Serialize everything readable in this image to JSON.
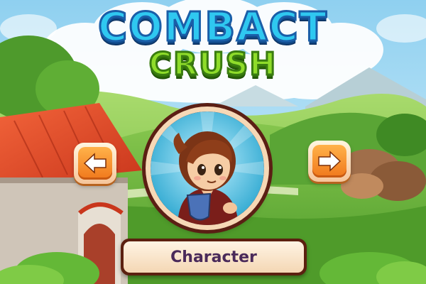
{
  "game": {
    "title_line1": "COMBACT",
    "title_line2": "CRUSH",
    "character_button_label": "Character"
  },
  "icons": {
    "prev": "arrow-left-icon",
    "next": "arrow-right-icon"
  },
  "colors": {
    "title_blue": "#2fc8f0",
    "title_green": "#8fdc2a",
    "arrow_orange": "#f0781c",
    "frame_brown": "#5b1f14",
    "sky": "#9fd6f2"
  }
}
